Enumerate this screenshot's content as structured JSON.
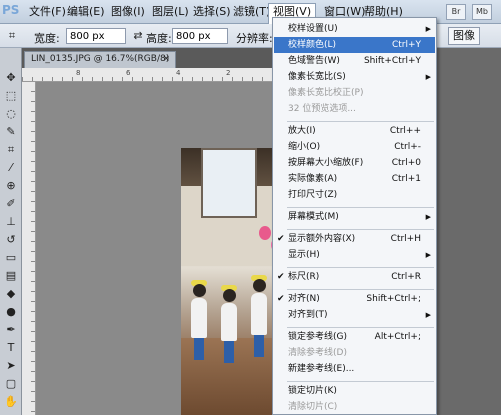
{
  "app": {
    "logo": "PS"
  },
  "menubar": {
    "items": [
      "文件(F)",
      "编辑(E)",
      "图像(I)",
      "图层(L)",
      "选择(S)",
      "滤镜(T)",
      "视图(V)",
      "窗口(W)",
      "帮助(H)"
    ],
    "mini_buttons": [
      "Br",
      "Mb"
    ]
  },
  "options": {
    "width_label": "宽度:",
    "width_value": "800 px",
    "height_label": "高度:",
    "height_value": "800 px",
    "resolution_label": "分辨率:",
    "image_button": "图像"
  },
  "document": {
    "tab_title": "LIN_0135.JPG @ 16.7%(RGB/8)",
    "close": "×"
  },
  "rulers": {
    "top_numbers": [
      "8",
      "6",
      "4",
      "2",
      "0",
      "2"
    ]
  },
  "view_menu": {
    "items": [
      {
        "label": "校样设置(U)",
        "shortcut": "",
        "arrow": true
      },
      {
        "label": "校样颜色(L)",
        "shortcut": "Ctrl+Y",
        "highlighted": true
      },
      {
        "label": "色域警告(W)",
        "shortcut": "Shift+Ctrl+Y"
      },
      {
        "label": "像素长宽比(S)",
        "shortcut": "",
        "arrow": true
      },
      {
        "label": "像素长宽比校正(P)",
        "shortcut": "",
        "disabled": true
      },
      {
        "label": "32 位预览选项...",
        "shortcut": "",
        "disabled": true
      },
      {
        "label": "放大(I)",
        "shortcut": "Ctrl++"
      },
      {
        "label": "缩小(O)",
        "shortcut": "Ctrl+-"
      },
      {
        "label": "按屏幕大小缩放(F)",
        "shortcut": "Ctrl+0"
      },
      {
        "label": "实际像素(A)",
        "shortcut": "Ctrl+1"
      },
      {
        "label": "打印尺寸(Z)",
        "shortcut": ""
      },
      {
        "label": "屏幕模式(M)",
        "shortcut": "",
        "arrow": true
      },
      {
        "label": "显示额外内容(X)",
        "shortcut": "Ctrl+H",
        "checked": true
      },
      {
        "label": "显示(H)",
        "shortcut": "",
        "arrow": true
      },
      {
        "label": "标尺(R)",
        "shortcut": "Ctrl+R",
        "checked": true
      },
      {
        "label": "对齐(N)",
        "shortcut": "Shift+Ctrl+;",
        "checked": true
      },
      {
        "label": "对齐到(T)",
        "shortcut": "",
        "arrow": true
      },
      {
        "label": "锁定参考线(G)",
        "shortcut": "Alt+Ctrl+;"
      },
      {
        "label": "清除参考线(D)",
        "shortcut": "",
        "disabled": true
      },
      {
        "label": "新建参考线(E)...",
        "shortcut": ""
      },
      {
        "label": "锁定切片(K)",
        "shortcut": ""
      },
      {
        "label": "清除切片(C)",
        "shortcut": "",
        "disabled": true
      }
    ]
  },
  "colors": {
    "highlight": "#3a76c9",
    "menubar": "#c2cfde"
  }
}
